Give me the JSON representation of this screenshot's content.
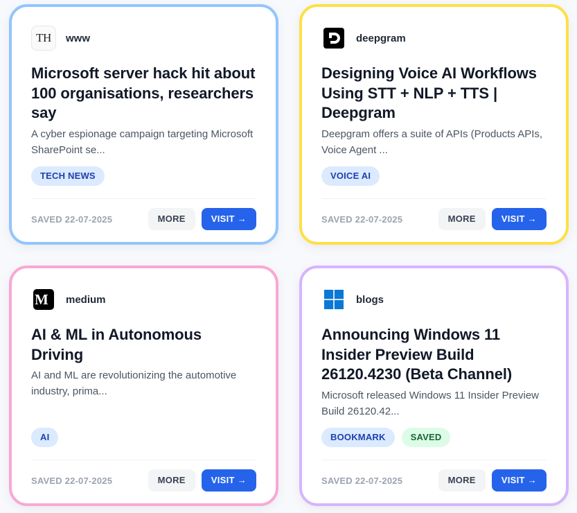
{
  "cards": [
    {
      "source": "www",
      "favicon": "th-newspaper-icon",
      "favicon_text": "TH",
      "title": "Microsoft server hack hit about 100 organisations, researchers say",
      "description": "A cyber espionage campaign targeting Microsoft SharePoint se...",
      "tags": [
        "TECH NEWS"
      ],
      "saved": "SAVED 22-07-2025",
      "more_label": "MORE",
      "visit_label": "VISIT →",
      "border_color": "#93c5fd"
    },
    {
      "source": "deepgram",
      "favicon": "deepgram-logo-icon",
      "title": "Designing Voice AI Workflows Using STT + NLP + TTS | Deepgram",
      "description": "Deepgram offers a suite of APIs (Products APIs, Voice Agent ...",
      "tags": [
        "VOICE AI"
      ],
      "saved": "SAVED 22-07-2025",
      "more_label": "MORE",
      "visit_label": "VISIT →",
      "border_color": "#fde047"
    },
    {
      "source": "medium",
      "favicon": "medium-logo-icon",
      "favicon_text": "M",
      "title": "AI & ML in Autonomous Driving",
      "description": "AI and ML are revolutionizing the automotive industry, prima...",
      "tags": [
        "AI"
      ],
      "saved": "SAVED 22-07-2025",
      "more_label": "MORE",
      "visit_label": "VISIT →",
      "border_color": "#f9a8d4"
    },
    {
      "source": "blogs",
      "favicon": "windows-logo-icon",
      "title": "Announcing Windows 11 Insider Preview Build 26120.4230 (Beta Channel)",
      "description": "Microsoft released Windows 11 Insider Preview Build 26120.42...",
      "tags": [
        "BOOKMARK",
        "SAVED"
      ],
      "saved": "SAVED 22-07-2025",
      "more_label": "MORE",
      "visit_label": "VISIT →",
      "border_color": "#d8b4fe"
    }
  ],
  "colors": {
    "tag_blue_bg": "#dbeafe",
    "tag_blue_text": "#1e40af",
    "tag_green_bg": "#dcfce7",
    "tag_green_text": "#166534",
    "visit_button": "#2563eb"
  }
}
